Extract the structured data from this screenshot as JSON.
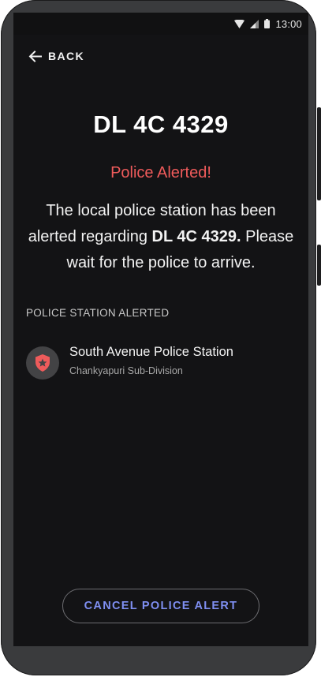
{
  "statusbar": {
    "time": "13:00"
  },
  "nav": {
    "back_label": "BACK"
  },
  "vehicle": {
    "plate": "DL 4C 4329"
  },
  "alert": {
    "title": "Police Alerted!",
    "message_part1": "The local police station has been alerted regarding ",
    "message_plate": "DL 4C 4329.",
    "message_part2": " Please wait for the police to arrive."
  },
  "station_section": {
    "title": "POLICE STATION ALERTED",
    "station": {
      "name": "South Avenue Police Station",
      "subdivision": "Chankyapuri Sub-Division",
      "icon": "police-badge-icon"
    }
  },
  "actions": {
    "cancel_label": "CANCEL POLICE ALERT"
  },
  "colors": {
    "alert": "#ef5b5b",
    "accent": "#7f8ff2",
    "background": "#131315"
  }
}
